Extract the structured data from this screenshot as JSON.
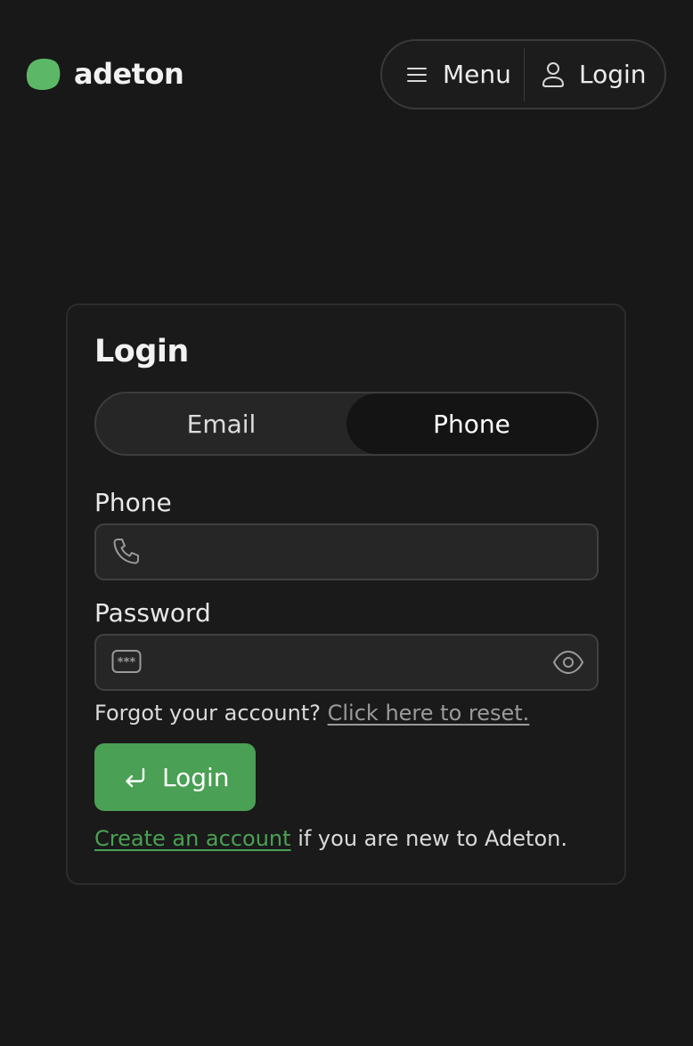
{
  "brand": {
    "name": "adeton",
    "color": "#4aa054"
  },
  "nav": {
    "menu_label": "Menu",
    "login_label": "Login",
    "menu_icon": "hamburger-icon",
    "login_icon": "user-icon"
  },
  "login_form": {
    "title": "Login",
    "tabs": [
      {
        "label": "Email",
        "active": false
      },
      {
        "label": "Phone",
        "active": true
      }
    ],
    "phone": {
      "label": "Phone",
      "value": "",
      "icon": "phone-icon"
    },
    "password": {
      "label": "Password",
      "value": "",
      "icon": "password-icon",
      "toggle_icon": "eye-icon"
    },
    "forgot_text": "Forgot your account?",
    "forgot_link": "Click here to reset.",
    "submit_label": "Login",
    "submit_icon": "enter-icon",
    "signup_link": "Create an account",
    "signup_text": "if you are new to Adeton."
  }
}
